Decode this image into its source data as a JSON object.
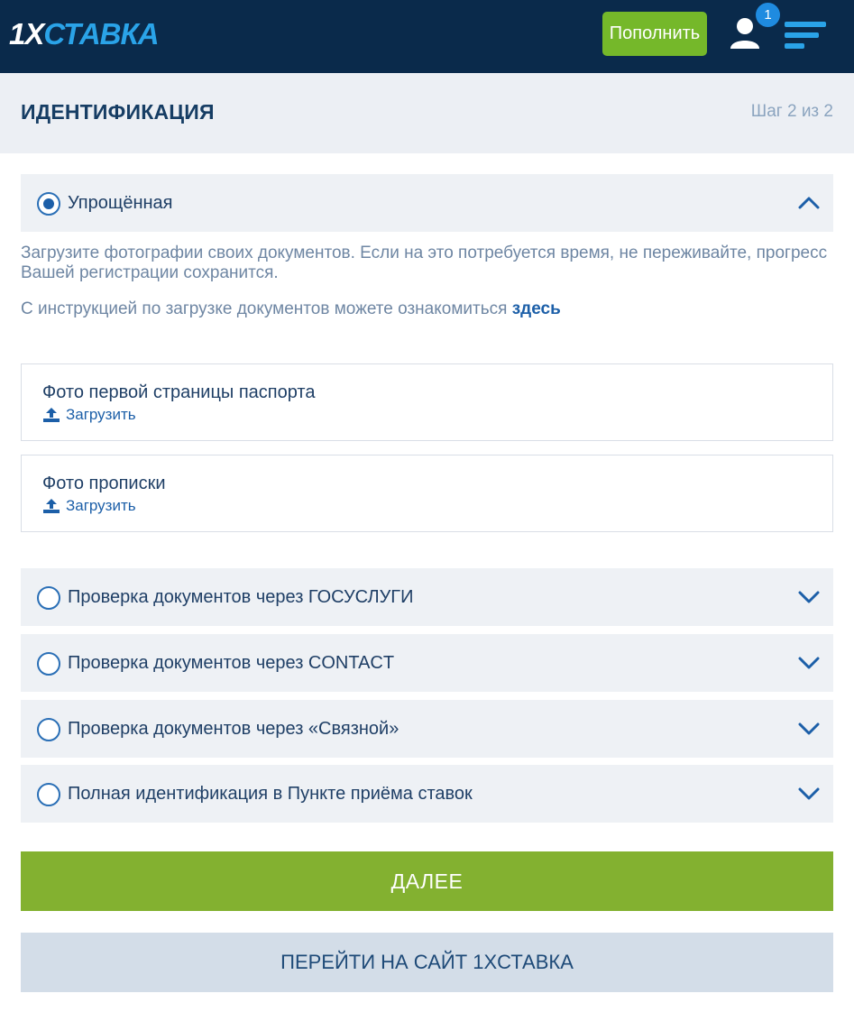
{
  "topbar": {
    "logo_part1": "1X",
    "logo_part2": "СТАВКА",
    "topup_label": "Пополнить",
    "notification_count": "1",
    "icons": {
      "user": "user-icon",
      "menu": "menu-icon"
    },
    "colors": {
      "bar": "#0a2a4b",
      "topup": "#75b82a",
      "logo_accent": "#2aa3e8",
      "badge": "#1f8be0"
    }
  },
  "header": {
    "title": "ИДЕНТИФИКАЦИЯ",
    "step": "Шаг 2 из 2"
  },
  "simplified": {
    "label": "Упрощённая",
    "selected": true,
    "expanded": true,
    "description": "Загрузите фотографии своих документов. Если на это потребуется время, не переживайте, прогресс Вашей регистрации сохранится.",
    "instruction_text": "С инструкцией по загрузке документов можете ознакомиться ",
    "instruction_link": "здесь",
    "uploads": [
      {
        "title": "Фото первой страницы паспорта",
        "action": "Загрузить"
      },
      {
        "title": "Фото прописки",
        "action": "Загрузить"
      }
    ]
  },
  "options": [
    {
      "label": "Проверка документов через ГОСУСЛУГИ"
    },
    {
      "label": "Проверка документов через CONTACT"
    },
    {
      "label": "Проверка документов через «Связной»"
    },
    {
      "label": "Полная идентификация в Пункте приёма ставок"
    }
  ],
  "actions": {
    "next_label": "ДАЛЕЕ",
    "site_label": "ПЕРЕЙТИ НА САЙТ 1XСТАВКА",
    "colors": {
      "next": "#83b130",
      "site": "#d3dde8"
    }
  }
}
